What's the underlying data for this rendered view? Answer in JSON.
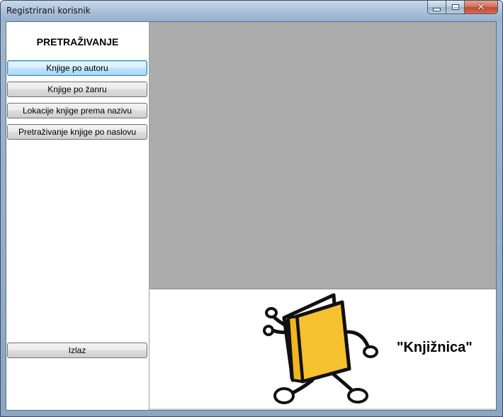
{
  "window": {
    "title": "Registrirani korisnik"
  },
  "sidebar": {
    "heading": "PRETRAŽIVANJE",
    "buttons": [
      {
        "label": "Knjige po autoru"
      },
      {
        "label": "Knjige po žanru"
      },
      {
        "label": "Lokacije knjige prema nazivu"
      },
      {
        "label": "Pretraživanje knjige po naslovu"
      }
    ],
    "exit_label": "Izlaz"
  },
  "branding": {
    "text": "\"Knjižnica\"",
    "mascot_icon": "running-book-icon",
    "mascot_color": "#F5C12E"
  }
}
